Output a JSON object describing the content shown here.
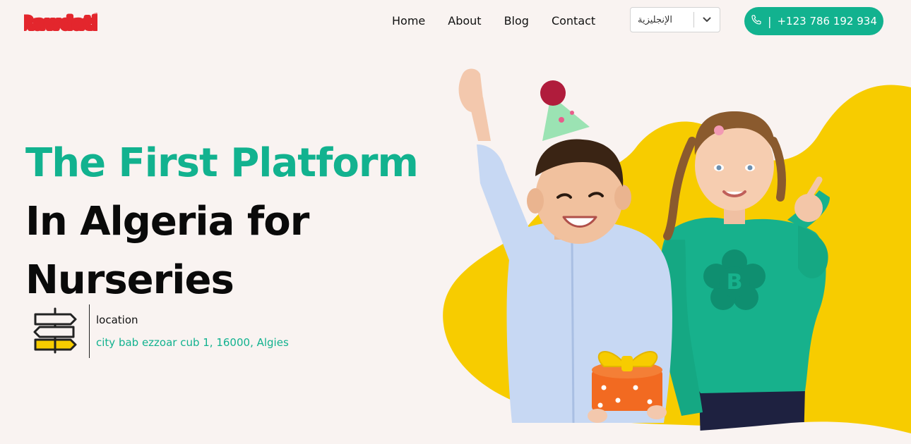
{
  "brand": {
    "logo_text": "Rawdati",
    "logo_mark": "™",
    "color": "#e3262d"
  },
  "nav": {
    "items": [
      {
        "label": "Home"
      },
      {
        "label": "About"
      },
      {
        "label": "Blog"
      },
      {
        "label": "Contact"
      }
    ]
  },
  "language_select": {
    "value": "الإنجليزية",
    "icon": "chevron-down-icon"
  },
  "phone_button": {
    "icon": "phone-icon",
    "separator": "|",
    "number": "+123 786 192 934",
    "color": "#12b28f"
  },
  "hero": {
    "line1": "The First Platform",
    "line2": "In Algeria for",
    "line3": "Nurseries",
    "accent_color": "#12b28f",
    "illustration_badge": "B"
  },
  "location": {
    "icon": "signpost-icon",
    "label": "location",
    "address": "city bab ezzoar cub 1, 16000, Algies"
  },
  "colors": {
    "background": "#f9f3f1",
    "blob": "#f7cc00"
  }
}
